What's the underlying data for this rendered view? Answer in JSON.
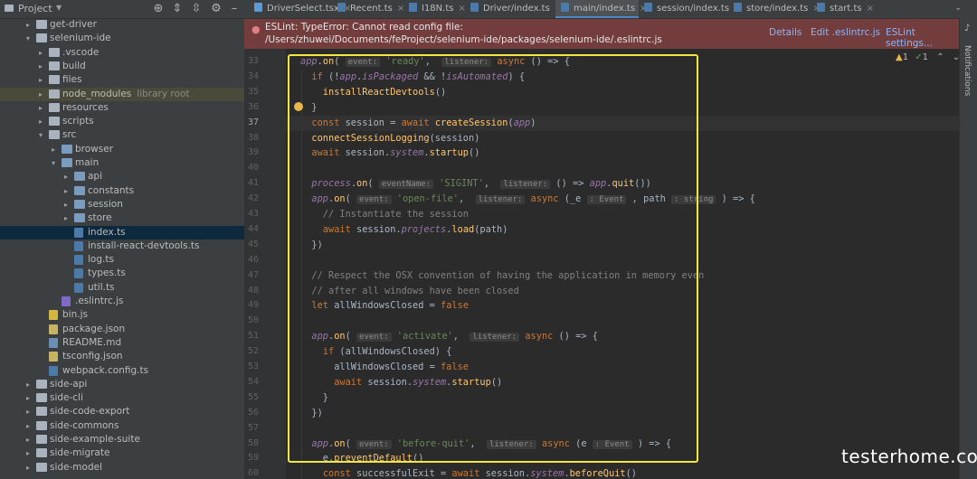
{
  "project_panel": {
    "title": "Project",
    "header_icons": [
      "crosshair-icon",
      "expand-all-icon",
      "collapse-all-icon",
      "gear-icon",
      "hide-icon"
    ],
    "tree": [
      {
        "label": "get-driver",
        "depth": 1,
        "kind": "folder",
        "expanded": false
      },
      {
        "label": "selenium-ide",
        "depth": 1,
        "kind": "folder",
        "expanded": true
      },
      {
        "label": ".vscode",
        "depth": 2,
        "kind": "folder",
        "expanded": false
      },
      {
        "label": "build",
        "depth": 2,
        "kind": "folder",
        "expanded": false
      },
      {
        "label": "files",
        "depth": 2,
        "kind": "folder",
        "expanded": false
      },
      {
        "label": "node_modules",
        "sub": "library root",
        "depth": 2,
        "kind": "folder",
        "expanded": false,
        "ignored": true
      },
      {
        "label": "resources",
        "depth": 2,
        "kind": "folder",
        "expanded": false
      },
      {
        "label": "scripts",
        "depth": 2,
        "kind": "folder",
        "expanded": false
      },
      {
        "label": "src",
        "depth": 2,
        "kind": "folder",
        "expanded": true
      },
      {
        "label": "browser",
        "depth": 3,
        "kind": "folder",
        "expanded": false
      },
      {
        "label": "main",
        "depth": 3,
        "kind": "folder",
        "expanded": true
      },
      {
        "label": "api",
        "depth": 4,
        "kind": "folder",
        "expanded": false
      },
      {
        "label": "constants",
        "depth": 4,
        "kind": "folder",
        "expanded": false
      },
      {
        "label": "session",
        "depth": 4,
        "kind": "folder",
        "expanded": false
      },
      {
        "label": "store",
        "depth": 4,
        "kind": "folder",
        "expanded": false
      },
      {
        "label": "index.ts",
        "depth": 4,
        "kind": "file",
        "selected": true
      },
      {
        "label": "install-react-devtools.ts",
        "depth": 4,
        "kind": "file"
      },
      {
        "label": "log.ts",
        "depth": 4,
        "kind": "file"
      },
      {
        "label": "types.ts",
        "depth": 4,
        "kind": "file"
      },
      {
        "label": "util.ts",
        "depth": 4,
        "kind": "file"
      },
      {
        "label": ".eslintrc.js",
        "depth": 3,
        "kind": "file-es"
      },
      {
        "label": "bin.js",
        "depth": 2,
        "kind": "file-js"
      },
      {
        "label": "package.json",
        "depth": 2,
        "kind": "file-json"
      },
      {
        "label": "README.md",
        "depth": 2,
        "kind": "file-md"
      },
      {
        "label": "tsconfig.json",
        "depth": 2,
        "kind": "file-json"
      },
      {
        "label": "webpack.config.ts",
        "depth": 2,
        "kind": "file"
      },
      {
        "label": "side-api",
        "depth": 1,
        "kind": "folder",
        "expanded": false
      },
      {
        "label": "side-cli",
        "depth": 1,
        "kind": "folder",
        "expanded": false
      },
      {
        "label": "side-code-export",
        "depth": 1,
        "kind": "folder",
        "expanded": false
      },
      {
        "label": "side-commons",
        "depth": 1,
        "kind": "folder",
        "expanded": false
      },
      {
        "label": "side-example-suite",
        "depth": 1,
        "kind": "folder",
        "expanded": false
      },
      {
        "label": "side-migrate",
        "depth": 1,
        "kind": "folder",
        "expanded": false
      },
      {
        "label": "side-model",
        "depth": 1,
        "kind": "folder",
        "expanded": false
      }
    ]
  },
  "tabs": [
    {
      "label": "DriverSelect.tsx",
      "type": "tsx",
      "active": false
    },
    {
      "label": "Recent.ts",
      "type": "ts",
      "active": false
    },
    {
      "label": "I18N.ts",
      "type": "ts",
      "active": false
    },
    {
      "label": "Driver/index.ts",
      "type": "ts",
      "active": false
    },
    {
      "label": "main/index.ts",
      "type": "ts",
      "active": true
    },
    {
      "label": "session/index.ts",
      "type": "ts",
      "active": false
    },
    {
      "label": "store/index.ts",
      "type": "ts",
      "active": false
    },
    {
      "label": "start.ts",
      "type": "ts",
      "active": false
    }
  ],
  "error_banner": {
    "title": "ESLint: TypeError: Cannot read config file:",
    "path": "/Users/zhuwei/Documents/feProject/selenium-ide/packages/selenium-ide/.eslintrc.js",
    "actions": [
      "Details",
      "Edit .eslintrc.js",
      "ESLint settings..."
    ],
    "close": "×"
  },
  "inspection": {
    "warnings": "1",
    "ok": "1"
  },
  "right_strip": {
    "label": "Notifications"
  },
  "editor": {
    "current_line": 37,
    "lines": [
      {
        "n": 33,
        "html": "<span class=\"p\">app</span>.<span class=\"f\">on</span>( <span class=\"hint\">event:</span> <span class=\"s\">'ready'</span>,  <span class=\"hint\">listener:</span> <span class=\"k\">async</span> () => {"
      },
      {
        "n": 34,
        "html": "  <span class=\"k\">if</span> (!<span class=\"p\">app</span>.<span class=\"p\">isPackaged</span> && !<span class=\"p\">isAutomated</span>) {"
      },
      {
        "n": 35,
        "html": "    <span class=\"f\">installReactDevtools</span>()"
      },
      {
        "n": 36,
        "html": "  }"
      },
      {
        "n": 37,
        "html": "  <span class=\"k\">const</span> session = <span class=\"k\">await</span> <span class=\"f\">createSession</span>(<span class=\"p\">app</span>)"
      },
      {
        "n": 38,
        "html": "  <span class=\"f\">connectSessionLogging</span>(session)"
      },
      {
        "n": 39,
        "html": "  <span class=\"k\">await</span> session.<span class=\"p\">system</span>.<span class=\"f\">startup</span>()"
      },
      {
        "n": 40,
        "html": ""
      },
      {
        "n": 41,
        "html": "  <span class=\"p\">process</span>.<span class=\"f\">on</span>( <span class=\"hint\">eventName:</span> <span class=\"s\">'SIGINT'</span>,  <span class=\"hint\">listener:</span> () => <span class=\"p\">app</span>.<span class=\"f\">quit</span>())"
      },
      {
        "n": 42,
        "html": "  <span class=\"p\">app</span>.<span class=\"f\">on</span>( <span class=\"hint\">event:</span> <span class=\"s\">'open-file'</span>,  <span class=\"hint\">listener:</span> <span class=\"k\">async</span> (_e <span class=\"hint\">: Event</span> , path <span class=\"hint\">: string</span> ) => {"
      },
      {
        "n": 43,
        "html": "    <span class=\"c\">// Instantiate the session</span>"
      },
      {
        "n": 44,
        "html": "    <span class=\"k\">await</span> session.<span class=\"p\">projects</span>.<span class=\"f\">load</span>(path)"
      },
      {
        "n": 45,
        "html": "  })"
      },
      {
        "n": 46,
        "html": ""
      },
      {
        "n": 47,
        "html": "  <span class=\"c\">// Respect the OSX convention of having the application in memory even</span>"
      },
      {
        "n": 48,
        "html": "  <span class=\"c\">// after all windows have been closed</span>"
      },
      {
        "n": 49,
        "html": "  <span class=\"k\">let</span> allWindowsClosed = <span class=\"k\">false</span>"
      },
      {
        "n": 50,
        "html": ""
      },
      {
        "n": 51,
        "html": "  <span class=\"p\">app</span>.<span class=\"f\">on</span>( <span class=\"hint\">event:</span> <span class=\"s\">'activate'</span>,  <span class=\"hint\">listener:</span> <span class=\"k\">async</span> () => {"
      },
      {
        "n": 52,
        "html": "    <span class=\"k\">if</span> (allWindowsClosed) {"
      },
      {
        "n": 53,
        "html": "      allWindowsClosed = <span class=\"k\">false</span>"
      },
      {
        "n": 54,
        "html": "      <span class=\"k\">await</span> session.<span class=\"p\">system</span>.<span class=\"f\">startup</span>()"
      },
      {
        "n": 55,
        "html": "    }"
      },
      {
        "n": 56,
        "html": "  })"
      },
      {
        "n": 57,
        "html": ""
      },
      {
        "n": 58,
        "html": "  <span class=\"p\">app</span>.<span class=\"f\">on</span>( <span class=\"hint\">event:</span> <span class=\"s\">'before-quit'</span>,  <span class=\"hint\">listener:</span> <span class=\"k\">async</span> (e <span class=\"hint\">: Event</span> ) => {"
      },
      {
        "n": 59,
        "html": "    e.<span class=\"f\">preventDefault</span>()"
      },
      {
        "n": 60,
        "html": "    <span class=\"k\">const</span> successfulExit = <span class=\"k\">await</span> session.<span class=\"p\">system</span>.<span class=\"f\">beforeQuit</span>()"
      }
    ]
  },
  "watermark": "testerhome.com",
  "colors": {
    "accent": "#4a88c7",
    "selection_box": "#f5e642",
    "error_banner": "#743d3d"
  }
}
